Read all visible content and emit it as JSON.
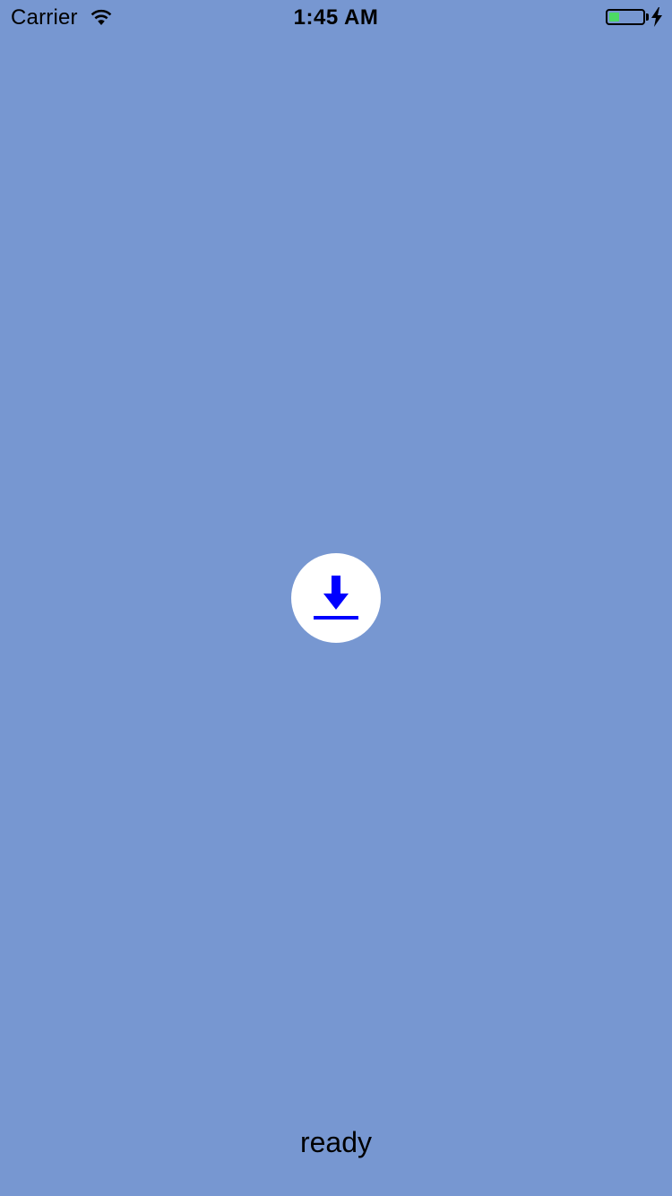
{
  "status_bar": {
    "carrier": "Carrier",
    "time": "1:45 AM",
    "battery_level": 0.3,
    "battery_color": "#4cd964",
    "charging": true,
    "icons": [
      "wifi-icon",
      "battery-icon",
      "charging-bolt-icon"
    ]
  },
  "background_color": "#7797d1",
  "download_button": {
    "icon": "download-icon",
    "icon_color": "#0000ff",
    "background_color": "#ffffff"
  },
  "status": {
    "text": "ready"
  }
}
